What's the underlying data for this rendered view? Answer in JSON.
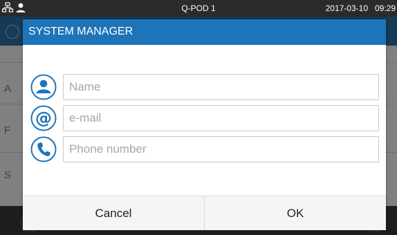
{
  "status_bar": {
    "title": "Q-POD 1",
    "date": "2017-03-10",
    "time": "09:29",
    "icons": [
      "network-icon",
      "user-icon"
    ]
  },
  "background": {
    "row_letters": [
      "A",
      "F",
      "S"
    ]
  },
  "dialog": {
    "title": "SYSTEM MANAGER",
    "header_color": "#1e74b8",
    "icon_color": "#1e74b8",
    "fields": [
      {
        "icon": "person-icon",
        "placeholder": "Name",
        "value": ""
      },
      {
        "icon": "at-sign-icon",
        "placeholder": "e-mail",
        "value": ""
      },
      {
        "icon": "phone-icon",
        "placeholder": "Phone number",
        "value": ""
      }
    ],
    "buttons": {
      "cancel": "Cancel",
      "ok": "OK"
    }
  }
}
